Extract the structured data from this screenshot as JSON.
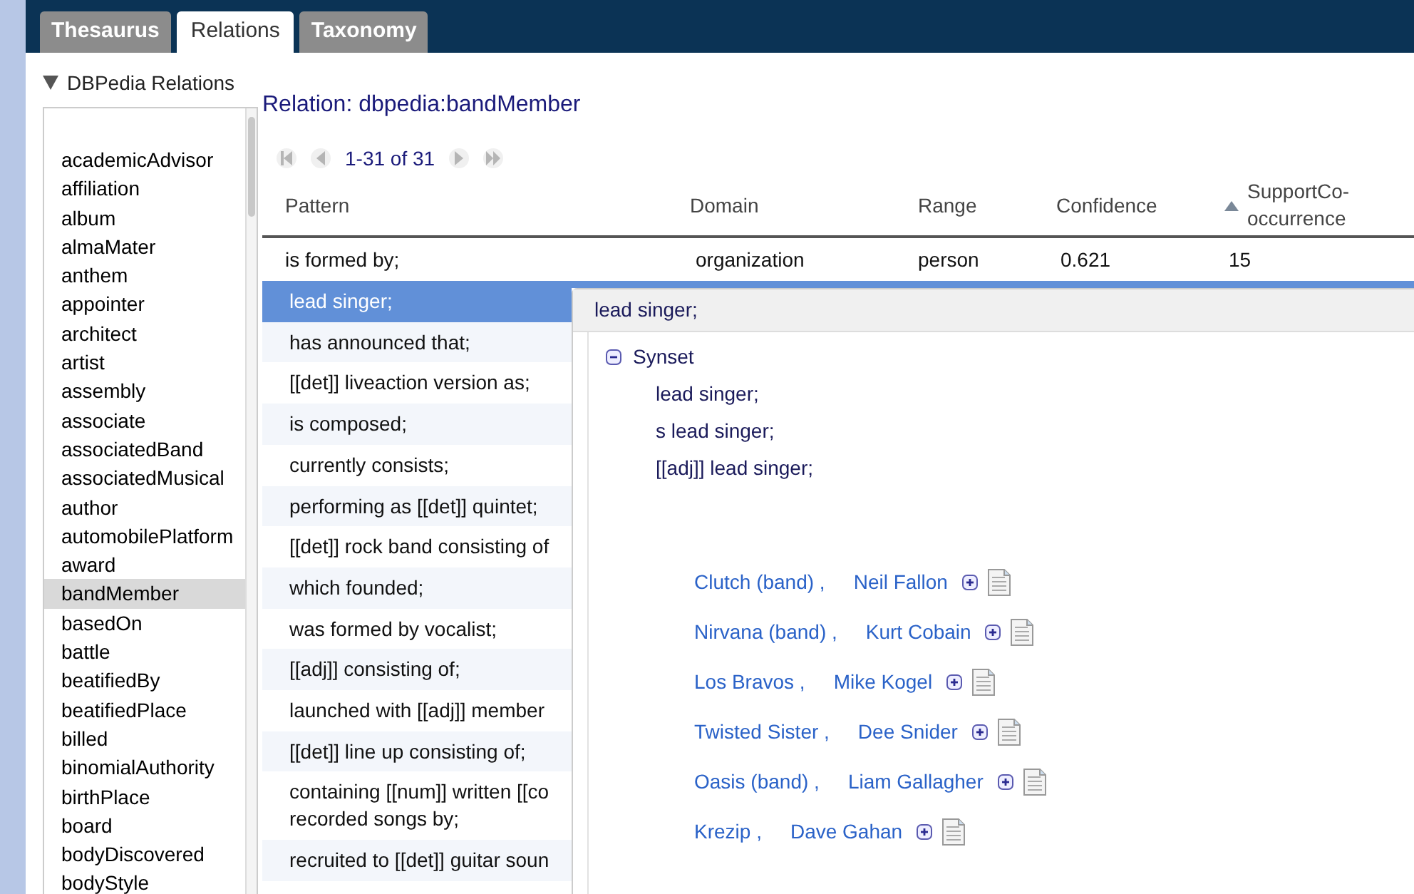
{
  "tabs": [
    {
      "label": "Thesaurus",
      "selected": false
    },
    {
      "label": "Relations",
      "selected": true
    },
    {
      "label": "Taxonomy",
      "selected": false
    }
  ],
  "sidebar": {
    "title": "DBPedia Relations",
    "expanded": true,
    "items": [
      {
        "label": "academicAdvisor",
        "selected": false
      },
      {
        "label": "affiliation",
        "selected": false
      },
      {
        "label": "album",
        "selected": false
      },
      {
        "label": "almaMater",
        "selected": false
      },
      {
        "label": "anthem",
        "selected": false
      },
      {
        "label": "appointer",
        "selected": false
      },
      {
        "label": "architect",
        "selected": false
      },
      {
        "label": "artist",
        "selected": false
      },
      {
        "label": "assembly",
        "selected": false
      },
      {
        "label": "associate",
        "selected": false
      },
      {
        "label": "associatedBand",
        "selected": false
      },
      {
        "label": "associatedMusical",
        "selected": false
      },
      {
        "label": "author",
        "selected": false
      },
      {
        "label": "automobilePlatform",
        "selected": false
      },
      {
        "label": "award",
        "selected": false
      },
      {
        "label": "bandMember",
        "selected": true
      },
      {
        "label": "basedOn",
        "selected": false
      },
      {
        "label": "battle",
        "selected": false
      },
      {
        "label": "beatifiedBy",
        "selected": false
      },
      {
        "label": "beatifiedPlace",
        "selected": false
      },
      {
        "label": "billed",
        "selected": false
      },
      {
        "label": "binomialAuthority",
        "selected": false
      },
      {
        "label": "birthPlace",
        "selected": false
      },
      {
        "label": "board",
        "selected": false
      },
      {
        "label": "bodyDiscovered",
        "selected": false
      },
      {
        "label": "bodyStyle",
        "selected": false
      }
    ]
  },
  "relation_title": "Relation: dbpedia:bandMember",
  "pager": {
    "range": "1-31 of 31"
  },
  "table": {
    "columns": [
      {
        "label": "Pattern",
        "sorted": false
      },
      {
        "label": "Domain",
        "sorted": false
      },
      {
        "label": "Range",
        "sorted": false
      },
      {
        "label": "Confidence",
        "sorted": false
      },
      {
        "label": "SupportCo-occurrence",
        "sorted": true
      }
    ],
    "rows": [
      {
        "cells": [
          "is formed by;",
          "organization",
          "person",
          "0.621",
          "15"
        ],
        "selected": false
      },
      {
        "cells": [
          "lead singer;"
        ],
        "selected": true
      },
      {
        "cells": [
          "has announced that;"
        ],
        "selected": false
      },
      {
        "cells": [
          "[[det]] liveaction version as;"
        ],
        "selected": false
      },
      {
        "cells": [
          "is composed;"
        ],
        "selected": false
      },
      {
        "cells": [
          "currently consists;"
        ],
        "selected": false
      },
      {
        "cells": [
          "performing as [[det]] quintet;"
        ],
        "selected": false
      },
      {
        "cells": [
          "[[det]] rock band consisting of"
        ],
        "selected": false
      },
      {
        "cells": [
          "which founded;"
        ],
        "selected": false
      },
      {
        "cells": [
          "was formed by vocalist;"
        ],
        "selected": false
      },
      {
        "cells": [
          "[[adj]] consisting of;"
        ],
        "selected": false
      },
      {
        "cells": [
          "launched with [[adj]] member"
        ],
        "selected": false
      },
      {
        "cells": [
          "[[det]] line up consisting of;"
        ],
        "selected": false
      },
      {
        "cells": [
          "containing [[num]] written [[co recorded songs by;"
        ],
        "selected": false
      },
      {
        "cells": [
          "recruited to [[det]] guitar soun"
        ],
        "selected": false
      }
    ]
  },
  "popup": {
    "title": "lead singer;",
    "synset": {
      "label": "Synset",
      "expanded": true,
      "items": [
        "lead singer;",
        "s lead singer;",
        "[[adj]] lead singer;"
      ]
    },
    "pairs": [
      {
        "subject": "Clutch (band) ,",
        "object": "Neil Fallon"
      },
      {
        "subject": "Nirvana (band) ,",
        "object": "Kurt Cobain"
      },
      {
        "subject": "Los Bravos ,",
        "object": "Mike Kogel"
      },
      {
        "subject": "Twisted Sister ,",
        "object": "Dee Snider"
      },
      {
        "subject": "Oasis (band) ,",
        "object": "Liam Gallagher"
      },
      {
        "subject": "Krezip ,",
        "object": "Dave Gahan"
      }
    ]
  }
}
